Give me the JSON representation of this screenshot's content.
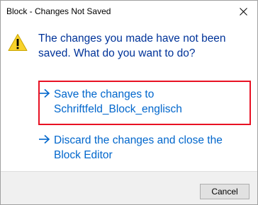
{
  "window": {
    "title": "Block - Changes Not Saved",
    "close_icon": "close-icon"
  },
  "message": {
    "icon": "warning-icon",
    "instruction": "The changes you made have not been saved. What do you want to do?"
  },
  "commands": [
    {
      "icon": "arrow-right-icon",
      "label": "Save the changes to Schriftfeld_Block_englisch",
      "highlighted": true
    },
    {
      "icon": "arrow-right-icon",
      "label": "Discard the changes and close the Block Editor",
      "highlighted": false
    }
  ],
  "footer": {
    "cancel_label": "Cancel"
  },
  "colors": {
    "instruction_text": "#003399",
    "link_text": "#0066cc",
    "highlight_border": "#e81123",
    "warning_yellow": "#f8d22b"
  }
}
